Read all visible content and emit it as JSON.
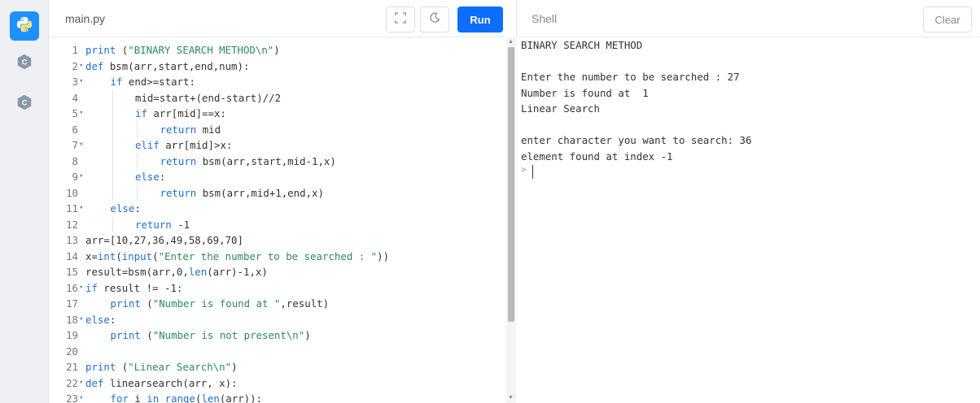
{
  "editor": {
    "filename": "main.py",
    "run_label": "Run",
    "lines": [
      {
        "n": "1",
        "fold": "",
        "indent": 0,
        "tokens": [
          [
            "kw",
            "print"
          ],
          [
            "",
            " ("
          ],
          [
            "str",
            "\"BINARY SEARCH METHOD\\n\""
          ],
          [
            "",
            ")"
          ]
        ]
      },
      {
        "n": "2",
        "fold": "▾",
        "indent": 0,
        "tokens": [
          [
            "kw",
            "def"
          ],
          [
            "",
            " bsm(arr,start,end,num):"
          ]
        ]
      },
      {
        "n": "3",
        "fold": "▾",
        "indent": 1,
        "tokens": [
          [
            "kw",
            "if"
          ],
          [
            "",
            " end>=start:"
          ]
        ]
      },
      {
        "n": "4",
        "fold": "",
        "indent": 2,
        "tokens": [
          [
            "",
            "mid=start+(end-start)//2"
          ]
        ]
      },
      {
        "n": "5",
        "fold": "▾",
        "indent": 2,
        "tokens": [
          [
            "kw",
            "if"
          ],
          [
            "",
            " arr[mid]==x:"
          ]
        ]
      },
      {
        "n": "6",
        "fold": "",
        "indent": 3,
        "tokens": [
          [
            "kw",
            "return"
          ],
          [
            "",
            " mid"
          ]
        ]
      },
      {
        "n": "7",
        "fold": "▾",
        "indent": 2,
        "tokens": [
          [
            "kw",
            "elif"
          ],
          [
            "",
            " arr[mid]>x:"
          ]
        ]
      },
      {
        "n": "8",
        "fold": "",
        "indent": 3,
        "tokens": [
          [
            "kw",
            "return"
          ],
          [
            "",
            " bsm(arr,start,mid-1,x)"
          ]
        ]
      },
      {
        "n": "9",
        "fold": "▾",
        "indent": 2,
        "tokens": [
          [
            "kw",
            "else"
          ],
          [
            "",
            ":"
          ]
        ]
      },
      {
        "n": "10",
        "fold": "",
        "indent": 3,
        "tokens": [
          [
            "kw",
            "return"
          ],
          [
            "",
            " bsm(arr,mid+1,end,x)"
          ]
        ]
      },
      {
        "n": "11",
        "fold": "▾",
        "indent": 1,
        "tokens": [
          [
            "kw",
            "else"
          ],
          [
            "",
            ":"
          ]
        ]
      },
      {
        "n": "12",
        "fold": "",
        "indent": 2,
        "tokens": [
          [
            "kw",
            "return"
          ],
          [
            "",
            " -1"
          ]
        ]
      },
      {
        "n": "13",
        "fold": "",
        "indent": 0,
        "tokens": [
          [
            "",
            "arr=[10,27,36,49,58,69,70]"
          ]
        ]
      },
      {
        "n": "14",
        "fold": "",
        "indent": 0,
        "tokens": [
          [
            "",
            "x="
          ],
          [
            "kw",
            "int"
          ],
          [
            "",
            "("
          ],
          [
            "kw",
            "input"
          ],
          [
            "",
            "("
          ],
          [
            "str",
            "\"Enter the number to be searched : \""
          ],
          [
            "",
            "))"
          ]
        ]
      },
      {
        "n": "15",
        "fold": "",
        "indent": 0,
        "tokens": [
          [
            "",
            "result=bsm(arr,0,"
          ],
          [
            "kw",
            "len"
          ],
          [
            "",
            "(arr)-1,x)"
          ]
        ]
      },
      {
        "n": "16",
        "fold": "▾",
        "indent": 0,
        "tokens": [
          [
            "kw",
            "if"
          ],
          [
            "",
            " result != -1:"
          ]
        ]
      },
      {
        "n": "17",
        "fold": "",
        "indent": 1,
        "tokens": [
          [
            "kw",
            "print"
          ],
          [
            "",
            " ("
          ],
          [
            "str",
            "\"Number is found at \""
          ],
          [
            "",
            ",result)"
          ]
        ]
      },
      {
        "n": "18",
        "fold": "▾",
        "indent": 0,
        "tokens": [
          [
            "kw",
            "else"
          ],
          [
            "",
            ":"
          ]
        ]
      },
      {
        "n": "19",
        "fold": "",
        "indent": 1,
        "tokens": [
          [
            "kw",
            "print"
          ],
          [
            "",
            " ("
          ],
          [
            "str",
            "\"Number is not present\\n\""
          ],
          [
            "",
            ")"
          ]
        ]
      },
      {
        "n": "20",
        "fold": "",
        "indent": 0,
        "tokens": []
      },
      {
        "n": "21",
        "fold": "",
        "indent": 0,
        "tokens": [
          [
            "kw",
            "print"
          ],
          [
            "",
            " ("
          ],
          [
            "str",
            "\"Linear Search\\n\""
          ],
          [
            "",
            ")"
          ]
        ]
      },
      {
        "n": "22",
        "fold": "▾",
        "indent": 0,
        "tokens": [
          [
            "kw",
            "def"
          ],
          [
            "",
            " linearsearch(arr, x):"
          ]
        ]
      },
      {
        "n": "23",
        "fold": "▾",
        "indent": 1,
        "tokens": [
          [
            "kw",
            "for"
          ],
          [
            "",
            " i "
          ],
          [
            "kw",
            "in"
          ],
          [
            "",
            " "
          ],
          [
            "kw",
            "range"
          ],
          [
            "",
            "("
          ],
          [
            "kw",
            "len"
          ],
          [
            "",
            "(arr)):"
          ]
        ]
      }
    ]
  },
  "shell": {
    "title": "Shell",
    "clear_label": "Clear",
    "output": [
      "BINARY SEARCH METHOD",
      "",
      "Enter the number to be searched : 27",
      "Number is found at  1",
      "Linear Search",
      "",
      "enter character you want to search: 36",
      "element found at index -1"
    ],
    "prompt": ">"
  },
  "colors": {
    "run_button": "#0d6efd",
    "active_rail": "#1e90ff",
    "keyword": "#1e6fcf",
    "string": "#2e8b57"
  },
  "icons": {
    "rail": [
      "python-icon",
      "c-language-icon",
      "c-language-icon"
    ],
    "header": [
      "fullscreen-icon",
      "moon-icon"
    ]
  }
}
